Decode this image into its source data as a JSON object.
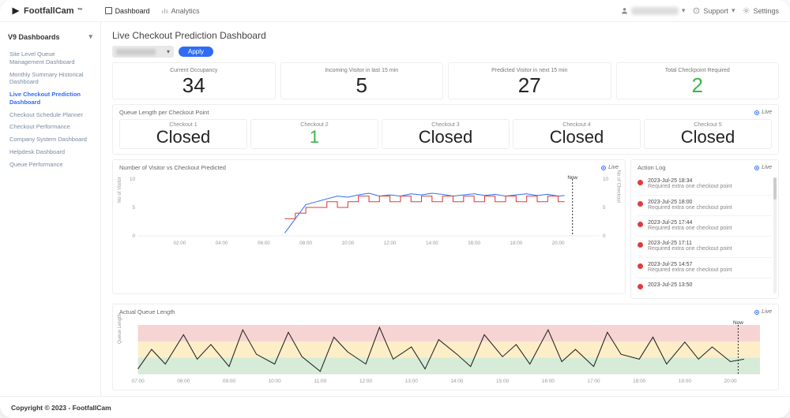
{
  "brand": "FootfallCam",
  "brand_tm": "™",
  "topnav": {
    "dashboard": "Dashboard",
    "analytics": "Analytics"
  },
  "topright": {
    "support": "Support",
    "settings": "Settings"
  },
  "sidebar": {
    "title": "V9 Dashboards",
    "items": [
      "Site Level Queue Management Dashboard",
      "Monthly Summary Historical Dashboard",
      "Live Checkout Prediction Dashboard",
      "Checkout Schedule Planner",
      "Checkout Performance",
      "Company System Dashboard",
      "Helpdesk Dashboard",
      "Queue Performance"
    ],
    "active_index": 2
  },
  "page_title": "Live Checkout Prediction Dashboard",
  "apply_label": "Apply",
  "kpis": [
    {
      "label": "Current Occupancy",
      "value": "34"
    },
    {
      "label": "Incoming Visitor in last 15 min",
      "value": "5"
    },
    {
      "label": "Predicted Visitor in next 15 min",
      "value": "27"
    },
    {
      "label": "Total Checkpoint Required",
      "value": "2",
      "green": true
    }
  ],
  "queue_section_title": "Queue Length per Checkout Point",
  "live_label": "Live",
  "checkouts": [
    {
      "label": "Checkout 1",
      "value": "Closed"
    },
    {
      "label": "Checkout 2",
      "value": "1",
      "green": true
    },
    {
      "label": "Checkout 3",
      "value": "Closed"
    },
    {
      "label": "Checkout 4",
      "value": "Closed"
    },
    {
      "label": "Checkout 5",
      "value": "Closed"
    }
  ],
  "chart_data": [
    {
      "type": "line",
      "title": "Number of Visitor vs Checkout Predicted",
      "xlabel": "",
      "ylabel_left": "No of Visitor",
      "ylabel_right": "No of Checkout",
      "x_ticks": [
        "02:00",
        "04:00",
        "06:00",
        "08:00",
        "10:00",
        "12:00",
        "14:00",
        "16:00",
        "18:00",
        "20:00"
      ],
      "y_left_ticks": [
        "0",
        "5",
        "10"
      ],
      "y_right_ticks": [
        "0",
        "5",
        "10"
      ],
      "now_marker": "Now",
      "now_x_ratio": 0.94,
      "series": [
        {
          "name": "visitors",
          "color": "#2f6cf6",
          "x": [
            7.0,
            7.2,
            7.5,
            7.8,
            8.0,
            8.5,
            9.0,
            9.5,
            10,
            10.5,
            11,
            11.5,
            12,
            12.5,
            13,
            13.5,
            14,
            14.5,
            15,
            15.5,
            16,
            16.5,
            17,
            17.5,
            18,
            18.5,
            19,
            19.5,
            20,
            20.3
          ],
          "y": [
            0.5,
            1.5,
            3,
            4.5,
            5.5,
            6,
            6.5,
            7,
            6.8,
            7.2,
            7.5,
            7,
            7.2,
            7,
            7.4,
            7.2,
            7.5,
            7.3,
            7,
            7.2,
            7.4,
            7.1,
            7.3,
            7,
            7.2,
            7.4,
            7.1,
            7.3,
            7,
            7.1
          ]
        },
        {
          "name": "checkout_predicted",
          "color": "#e23b3b",
          "step": true,
          "x": [
            7.0,
            7.5,
            8.0,
            8.5,
            9.0,
            9.5,
            10,
            10.5,
            11,
            11.5,
            12,
            12.5,
            13,
            13.5,
            14,
            14.5,
            15,
            15.5,
            16,
            16.5,
            17,
            17.5,
            18,
            18.5,
            19,
            19.5,
            20,
            20.3
          ],
          "y": [
            3,
            4,
            5,
            5,
            6,
            5,
            6,
            7,
            6,
            7,
            6,
            7,
            6,
            7,
            6,
            7,
            6,
            7,
            6,
            7,
            6,
            7,
            6,
            7,
            6,
            7,
            6,
            6
          ]
        }
      ],
      "x_range": [
        0,
        22
      ],
      "y_range": [
        0,
        10
      ]
    },
    {
      "type": "line",
      "title": "Actual Queue Length",
      "xlabel": "",
      "ylabel_left": "Queue Length",
      "x_ticks": [
        "07:00",
        "08:00",
        "09:00",
        "10:00",
        "11:00",
        "12:00",
        "13:00",
        "14:00",
        "15:00",
        "16:00",
        "17:00",
        "18:00",
        "19:00",
        "20:00"
      ],
      "now_marker": "Now",
      "now_x_ratio": 0.965,
      "bands": [
        {
          "from": 0.66,
          "to": 1.0,
          "color": "#f6d4d4"
        },
        {
          "from": 0.33,
          "to": 0.66,
          "color": "#fdeec8"
        },
        {
          "from": 0.0,
          "to": 0.33,
          "color": "#d6ecd8"
        }
      ],
      "series": [
        {
          "name": "queue_length",
          "color": "#222",
          "x": [
            7,
            7.3,
            7.6,
            8,
            8.3,
            8.6,
            9,
            9.3,
            9.6,
            10,
            10.3,
            10.6,
            11,
            11.3,
            11.6,
            12,
            12.3,
            12.6,
            13,
            13.3,
            13.6,
            14,
            14.3,
            14.6,
            15,
            15.3,
            15.6,
            16,
            16.3,
            16.6,
            17,
            17.3,
            17.6,
            18,
            18.3,
            18.6,
            19,
            19.3,
            19.6,
            20,
            20.3
          ],
          "y": [
            0.1,
            0.5,
            0.2,
            0.8,
            0.3,
            0.6,
            0.15,
            0.9,
            0.4,
            0.2,
            0.85,
            0.35,
            0.05,
            0.75,
            0.45,
            0.2,
            0.95,
            0.3,
            0.55,
            0.1,
            0.7,
            0.4,
            0.15,
            0.8,
            0.35,
            0.6,
            0.2,
            0.9,
            0.25,
            0.5,
            0.15,
            0.85,
            0.4,
            0.3,
            0.75,
            0.2,
            0.65,
            0.3,
            0.55,
            0.25,
            0.3
          ]
        }
      ],
      "x_range": [
        7,
        20.5
      ],
      "y_range": [
        0,
        1
      ]
    }
  ],
  "action_log": {
    "title": "Action Log",
    "items": [
      {
        "ts": "2023-Jul-25 18:34",
        "msg": "Required extra one checkout point"
      },
      {
        "ts": "2023-Jul-25 18:00",
        "msg": "Required extra one checkout point"
      },
      {
        "ts": "2023-Jul-25 17:44",
        "msg": "Required extra one checkout point"
      },
      {
        "ts": "2023-Jul-25 17:11",
        "msg": "Required extra one checkout point"
      },
      {
        "ts": "2023-Jul-25 14:57",
        "msg": "Required extra one checkout point"
      },
      {
        "ts": "2023-Jul-25 13:50",
        "msg": ""
      }
    ]
  },
  "footer": "Copyright © 2023 - FootfallCam"
}
